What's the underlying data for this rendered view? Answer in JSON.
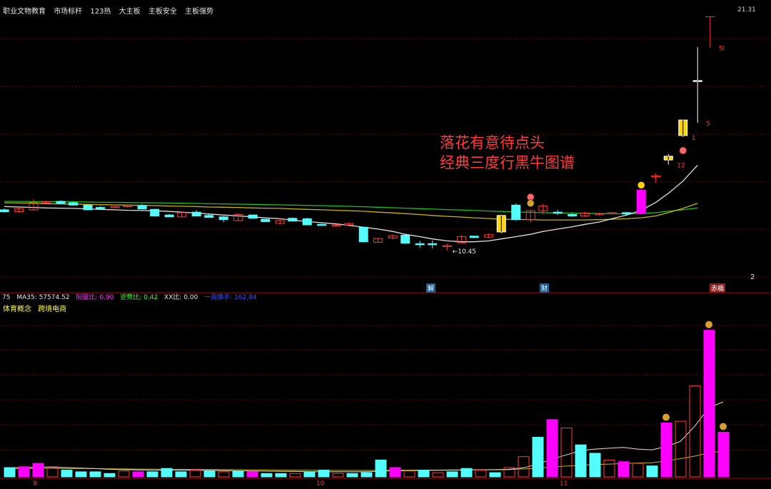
{
  "header": {
    "tags": [
      "职业文物教育",
      "市场标杆",
      "123热",
      "大主板",
      "主板安全",
      "主板强势"
    ],
    "top_price": "21.31"
  },
  "annotation": {
    "line1": "落花有意待点头",
    "line2": "经典三度行黑牛图谱"
  },
  "pane2_stats": [
    {
      "label": "75",
      "color": "#e6e6e6"
    },
    {
      "label": "MA35: 57574.52",
      "color": "#e6e6e6"
    },
    {
      "label": "阳量比: 0.90",
      "color": "#ff33ff"
    },
    {
      "label": "逆势比: 0.42",
      "color": "#33ff33"
    },
    {
      "label": "XX比: 0.00",
      "color": "#e6e6e6"
    },
    {
      "label": "一周换手: 162.84",
      "color": "#3355ff"
    }
  ],
  "concepts": [
    "体育概念",
    "跨境电商"
  ],
  "events": [
    "解",
    "财",
    "赤橋"
  ],
  "side_number": "2",
  "x_ticks": [
    "9",
    "10",
    "11"
  ],
  "colors": {
    "up": "#ff3b3b",
    "down": "#54fcfc",
    "limit_up": "#ffd400",
    "volume_up": "#ff00ff",
    "ma_white": "#e0e0e0",
    "ma_yellow": "#c9b400",
    "ma_green": "#19c019",
    "grid": "#7a0000"
  },
  "chart_data": {
    "type": "candlestick",
    "price_axis": {
      "min": 10.0,
      "max": 21.6
    },
    "low_label": "10.45",
    "high_label": "21.31",
    "candle_labels": [
      {
        "index": 48,
        "label": "12"
      },
      {
        "index": 49,
        "label": "1"
      },
      {
        "index": 50,
        "label": "5"
      },
      {
        "index": 51,
        "label": "5I"
      }
    ],
    "candles": [
      {
        "o": 13.1,
        "h": 13.16,
        "l": 12.98,
        "c": 13.02,
        "dir": "down"
      },
      {
        "o": 13.02,
        "h": 13.2,
        "l": 12.98,
        "c": 13.15,
        "dir": "up"
      },
      {
        "o": 13.1,
        "h": 13.55,
        "l": 13.05,
        "c": 13.42,
        "dir": "up"
      },
      {
        "o": 13.42,
        "h": 13.48,
        "l": 13.36,
        "c": 13.44,
        "dir": "up"
      },
      {
        "o": 13.46,
        "h": 13.5,
        "l": 13.36,
        "c": 13.38,
        "dir": "down"
      },
      {
        "o": 13.4,
        "h": 13.44,
        "l": 13.28,
        "c": 13.3,
        "dir": "down"
      },
      {
        "o": 13.3,
        "h": 13.32,
        "l": 13.08,
        "c": 13.1,
        "dir": "down"
      },
      {
        "o": 13.2,
        "h": 13.26,
        "l": 13.14,
        "c": 13.18,
        "dir": "down"
      },
      {
        "o": 13.22,
        "h": 13.26,
        "l": 13.18,
        "c": 13.24,
        "dir": "up"
      },
      {
        "o": 13.24,
        "h": 13.3,
        "l": 13.2,
        "c": 13.28,
        "dir": "up"
      },
      {
        "o": 13.28,
        "h": 13.34,
        "l": 13.12,
        "c": 13.14,
        "dir": "down"
      },
      {
        "o": 13.12,
        "h": 13.14,
        "l": 12.82,
        "c": 12.84,
        "dir": "down"
      },
      {
        "o": 12.88,
        "h": 12.92,
        "l": 12.78,
        "c": 12.8,
        "dir": "down"
      },
      {
        "o": 12.8,
        "h": 13.02,
        "l": 12.78,
        "c": 12.98,
        "dir": "up"
      },
      {
        "o": 13.0,
        "h": 13.08,
        "l": 12.82,
        "c": 12.84,
        "dir": "down"
      },
      {
        "o": 12.86,
        "h": 12.9,
        "l": 12.76,
        "c": 12.78,
        "dir": "down"
      },
      {
        "o": 12.8,
        "h": 12.84,
        "l": 12.58,
        "c": 12.68,
        "dir": "down"
      },
      {
        "o": 12.64,
        "h": 12.96,
        "l": 12.62,
        "c": 12.9,
        "dir": "up"
      },
      {
        "o": 12.88,
        "h": 12.9,
        "l": 12.72,
        "c": 12.74,
        "dir": "down"
      },
      {
        "o": 12.7,
        "h": 12.72,
        "l": 12.58,
        "c": 12.6,
        "dir": "down"
      },
      {
        "o": 12.52,
        "h": 12.74,
        "l": 12.48,
        "c": 12.64,
        "dir": "up"
      },
      {
        "o": 12.74,
        "h": 12.78,
        "l": 12.6,
        "c": 12.62,
        "dir": "down"
      },
      {
        "o": 12.72,
        "h": 12.76,
        "l": 12.44,
        "c": 12.46,
        "dir": "down"
      },
      {
        "o": 12.48,
        "h": 12.52,
        "l": 12.42,
        "c": 12.44,
        "dir": "down"
      },
      {
        "o": 12.44,
        "h": 12.5,
        "l": 12.4,
        "c": 12.46,
        "dir": "up"
      },
      {
        "o": 12.46,
        "h": 12.56,
        "l": 12.4,
        "c": 12.52,
        "dir": "up"
      },
      {
        "o": 12.36,
        "h": 12.38,
        "l": 11.72,
        "c": 11.74,
        "dir": "down"
      },
      {
        "o": 11.72,
        "h": 11.9,
        "l": 11.7,
        "c": 11.88,
        "dir": "up"
      },
      {
        "o": 11.9,
        "h": 12.04,
        "l": 11.84,
        "c": 12.0,
        "dir": "up"
      },
      {
        "o": 12.02,
        "h": 12.04,
        "l": 11.66,
        "c": 11.68,
        "dir": "down"
      },
      {
        "o": 11.66,
        "h": 11.78,
        "l": 11.48,
        "c": 11.64,
        "dir": "down"
      },
      {
        "o": 11.66,
        "h": 11.8,
        "l": 11.46,
        "c": 11.62,
        "dir": "down"
      },
      {
        "o": 11.54,
        "h": 11.66,
        "l": 11.36,
        "c": 11.58,
        "dir": "up"
      },
      {
        "o": 11.7,
        "h": 12.02,
        "l": 11.66,
        "c": 11.96,
        "dir": "up"
      },
      {
        "o": 11.98,
        "h": 12.0,
        "l": 11.9,
        "c": 11.92,
        "dir": "down"
      },
      {
        "o": 11.94,
        "h": 12.1,
        "l": 11.9,
        "c": 12.04,
        "dir": "up"
      },
      {
        "o": 12.16,
        "h": 12.9,
        "l": 12.1,
        "c": 12.86,
        "dir": "limit"
      },
      {
        "o": 13.3,
        "h": 13.38,
        "l": 12.64,
        "c": 12.68,
        "dir": "down"
      },
      {
        "o": 12.68,
        "h": 13.1,
        "l": 12.56,
        "c": 13.06,
        "dir": "up"
      },
      {
        "o": 13.06,
        "h": 13.34,
        "l": 12.92,
        "c": 13.26,
        "dir": "up"
      },
      {
        "o": 13.0,
        "h": 13.1,
        "l": 12.88,
        "c": 12.98,
        "dir": "down"
      },
      {
        "o": 12.9,
        "h": 12.98,
        "l": 12.8,
        "c": 12.84,
        "dir": "down"
      },
      {
        "o": 12.84,
        "h": 13.02,
        "l": 12.8,
        "c": 12.96,
        "dir": "up"
      },
      {
        "o": 12.92,
        "h": 12.98,
        "l": 12.86,
        "c": 12.94,
        "dir": "up"
      },
      {
        "o": 12.96,
        "h": 13.0,
        "l": 12.9,
        "c": 12.98,
        "dir": "up"
      },
      {
        "o": 12.98,
        "h": 13.02,
        "l": 12.86,
        "c": 12.92,
        "dir": "down"
      },
      {
        "o": 12.94,
        "h": 13.98,
        "l": 12.9,
        "c": 13.94,
        "dir": "volume_up"
      },
      {
        "o": 14.52,
        "h": 14.66,
        "l": 14.24,
        "c": 14.54,
        "dir": "up"
      },
      {
        "o": 15.22,
        "h": 15.48,
        "l": 15.02,
        "c": 15.38,
        "dir": "limit"
      },
      {
        "o": 16.26,
        "h": 16.92,
        "l": 16.2,
        "c": 16.92,
        "dir": "limit"
      },
      {
        "o": 18.6,
        "h": 20.02,
        "l": 16.8,
        "c": 18.6,
        "dir": "up_hollow"
      },
      {
        "o": 21.31,
        "h": 21.31,
        "l": 20.0,
        "c": 21.31,
        "dir": "top"
      }
    ],
    "price_x_index": [
      6,
      9.5,
      13,
      16,
      19.5,
      22.5,
      26,
      29,
      32.5,
      35.5,
      39,
      42,
      45.5,
      48.5,
      52,
      55,
      58.5,
      62,
      65.5,
      68.5,
      72,
      75,
      78.5,
      82,
      85.5,
      88.5,
      92,
      95.5,
      99,
      102,
      105.5,
      108.5,
      112,
      115.5,
      118.5,
      122,
      125,
      128.5,
      132,
      135,
      138.5,
      142,
      145,
      148.5,
      151.5,
      155,
      158.5,
      162,
      165,
      168.5,
      172,
      175
    ],
    "volume": {
      "max": 100,
      "bars": [
        {
          "v": 5.5,
          "t": "down"
        },
        {
          "v": 6.0,
          "t": "up"
        },
        {
          "v": 8.0,
          "t": "up"
        },
        {
          "v": 6.0,
          "t": "up_hollow"
        },
        {
          "v": 4.0,
          "t": "down"
        },
        {
          "v": 3.0,
          "t": "down"
        },
        {
          "v": 3.0,
          "t": "down"
        },
        {
          "v": 2.0,
          "t": "down"
        },
        {
          "v": 3.5,
          "t": "up_hollow"
        },
        {
          "v": 3.0,
          "t": "up"
        },
        {
          "v": 3.0,
          "t": "down"
        },
        {
          "v": 5.0,
          "t": "down"
        },
        {
          "v": 3.0,
          "t": "down"
        },
        {
          "v": 4.0,
          "t": "up_hollow"
        },
        {
          "v": 3.5,
          "t": "down"
        },
        {
          "v": 3.0,
          "t": "up_hollow"
        },
        {
          "v": 3.5,
          "t": "down"
        },
        {
          "v": 3.0,
          "t": "up"
        },
        {
          "v": 2.0,
          "t": "down"
        },
        {
          "v": 2.0,
          "t": "down"
        },
        {
          "v": 2.0,
          "t": "up_hollow"
        },
        {
          "v": 3.0,
          "t": "down"
        },
        {
          "v": 4.0,
          "t": "down"
        },
        {
          "v": 2.0,
          "t": "up_hollow"
        },
        {
          "v": 2.0,
          "t": "down"
        },
        {
          "v": 2.5,
          "t": "down"
        },
        {
          "v": 10.0,
          "t": "down"
        },
        {
          "v": 5.5,
          "t": "up"
        },
        {
          "v": 3.5,
          "t": "up_hollow"
        },
        {
          "v": 4.0,
          "t": "down"
        },
        {
          "v": 2.5,
          "t": "up_hollow"
        },
        {
          "v": 3.0,
          "t": "down"
        },
        {
          "v": 5.0,
          "t": "down"
        },
        {
          "v": 4.0,
          "t": "up_hollow"
        },
        {
          "v": 2.5,
          "t": "down"
        },
        {
          "v": 5.5,
          "t": "up_hollow"
        },
        {
          "v": 12.0,
          "t": "up_hollow"
        },
        {
          "v": 23.5,
          "t": "down"
        },
        {
          "v": 34.0,
          "t": "up"
        },
        {
          "v": 29.0,
          "t": "up_hollow"
        },
        {
          "v": 19.0,
          "t": "down"
        },
        {
          "v": 14.0,
          "t": "down"
        },
        {
          "v": 10.0,
          "t": "up_hollow"
        },
        {
          "v": 9.0,
          "t": "up"
        },
        {
          "v": 8.0,
          "t": "up_hollow"
        },
        {
          "v": 6.5,
          "t": "down"
        },
        {
          "v": 32.0,
          "t": "up"
        },
        {
          "v": 33.0,
          "t": "up_hollow"
        },
        {
          "v": 54.0,
          "t": "up_hollow"
        },
        {
          "v": 87.0,
          "t": "up"
        },
        {
          "v": 26.5,
          "t": "up"
        }
      ],
      "ma_white": [
        5.5,
        5.4,
        5.8,
        5.7,
        5.5,
        5.2,
        4.9,
        4.5,
        4.3,
        4.1,
        4.0,
        4.0,
        4.0,
        3.9,
        3.8,
        3.7,
        3.6,
        3.5,
        3.4,
        3.3,
        3.2,
        3.1,
        3.1,
        3.0,
        3.0,
        3.0,
        3.4,
        3.6,
        3.7,
        3.8,
        3.9,
        4.0,
        4.1,
        4.2,
        4.3,
        4.5,
        5.4,
        7.5,
        10.5,
        13.0,
        15.5,
        16.5,
        17.0,
        17.5,
        16.5,
        16.0,
        18.0,
        21.0,
        30.0,
        41.0,
        44.5
      ],
      "ma_yellow": [
        5.0,
        5.0,
        5.1,
        5.1,
        5.0,
        5.0,
        4.9,
        4.8,
        4.7,
        4.6,
        4.6,
        4.5,
        4.5,
        4.4,
        4.4,
        4.3,
        4.3,
        4.2,
        4.1,
        4.0,
        4.0,
        3.9,
        3.9,
        3.8,
        3.8,
        3.8,
        3.9,
        3.9,
        4.0,
        4.0,
        4.0,
        4.1,
        4.1,
        4.2,
        4.2,
        4.3,
        4.7,
        5.2,
        5.8,
        6.4,
        6.9,
        7.3,
        7.6,
        7.9,
        8.2,
        8.4,
        9.5,
        10.8,
        12.3,
        14.3,
        15.3
      ]
    },
    "ma_white": [
      13.24,
      13.22,
      13.2,
      13.18,
      13.17,
      13.16,
      13.14,
      13.12,
      13.1,
      13.08,
      13.07,
      13.06,
      13.03,
      13.0,
      12.96,
      12.92,
      12.88,
      12.84,
      12.8,
      12.76,
      12.72,
      12.66,
      12.6,
      12.55,
      12.5,
      12.44,
      12.36,
      12.28,
      12.18,
      12.06,
      11.96,
      11.86,
      11.78,
      11.74,
      11.74,
      11.78,
      11.86,
      11.96,
      12.06,
      12.18,
      12.28,
      12.38,
      12.48,
      12.58,
      12.72,
      12.88,
      13.08,
      13.42,
      13.8,
      14.32,
      15.0
    ],
    "ma_yellow": [
      13.4,
      13.39,
      13.38,
      13.36,
      13.35,
      13.34,
      13.33,
      13.32,
      13.31,
      13.3,
      13.29,
      13.28,
      13.26,
      13.25,
      13.24,
      13.22,
      13.21,
      13.2,
      13.18,
      13.17,
      13.16,
      13.14,
      13.12,
      13.1,
      13.08,
      13.06,
      13.04,
      13.0,
      12.97,
      12.94,
      12.9,
      12.86,
      12.82,
      12.79,
      12.76,
      12.73,
      12.7,
      12.69,
      12.68,
      12.67,
      12.67,
      12.67,
      12.67,
      12.68,
      12.7,
      12.72,
      12.76,
      12.84,
      12.98,
      13.16,
      13.38
    ],
    "ma_green": [
      13.46,
      13.46,
      13.45,
      13.45,
      13.44,
      13.44,
      13.43,
      13.42,
      13.42,
      13.41,
      13.4,
      13.4,
      13.39,
      13.38,
      13.37,
      13.36,
      13.35,
      13.34,
      13.33,
      13.32,
      13.31,
      13.3,
      13.29,
      13.28,
      13.26,
      13.25,
      13.23,
      13.21,
      13.19,
      13.17,
      13.15,
      13.13,
      13.11,
      13.09,
      13.07,
      13.05,
      13.03,
      13.01,
      12.99,
      12.98,
      12.97,
      12.96,
      12.95,
      12.94,
      12.93,
      12.93,
      12.94,
      12.98,
      13.04,
      13.1,
      13.18
    ]
  }
}
